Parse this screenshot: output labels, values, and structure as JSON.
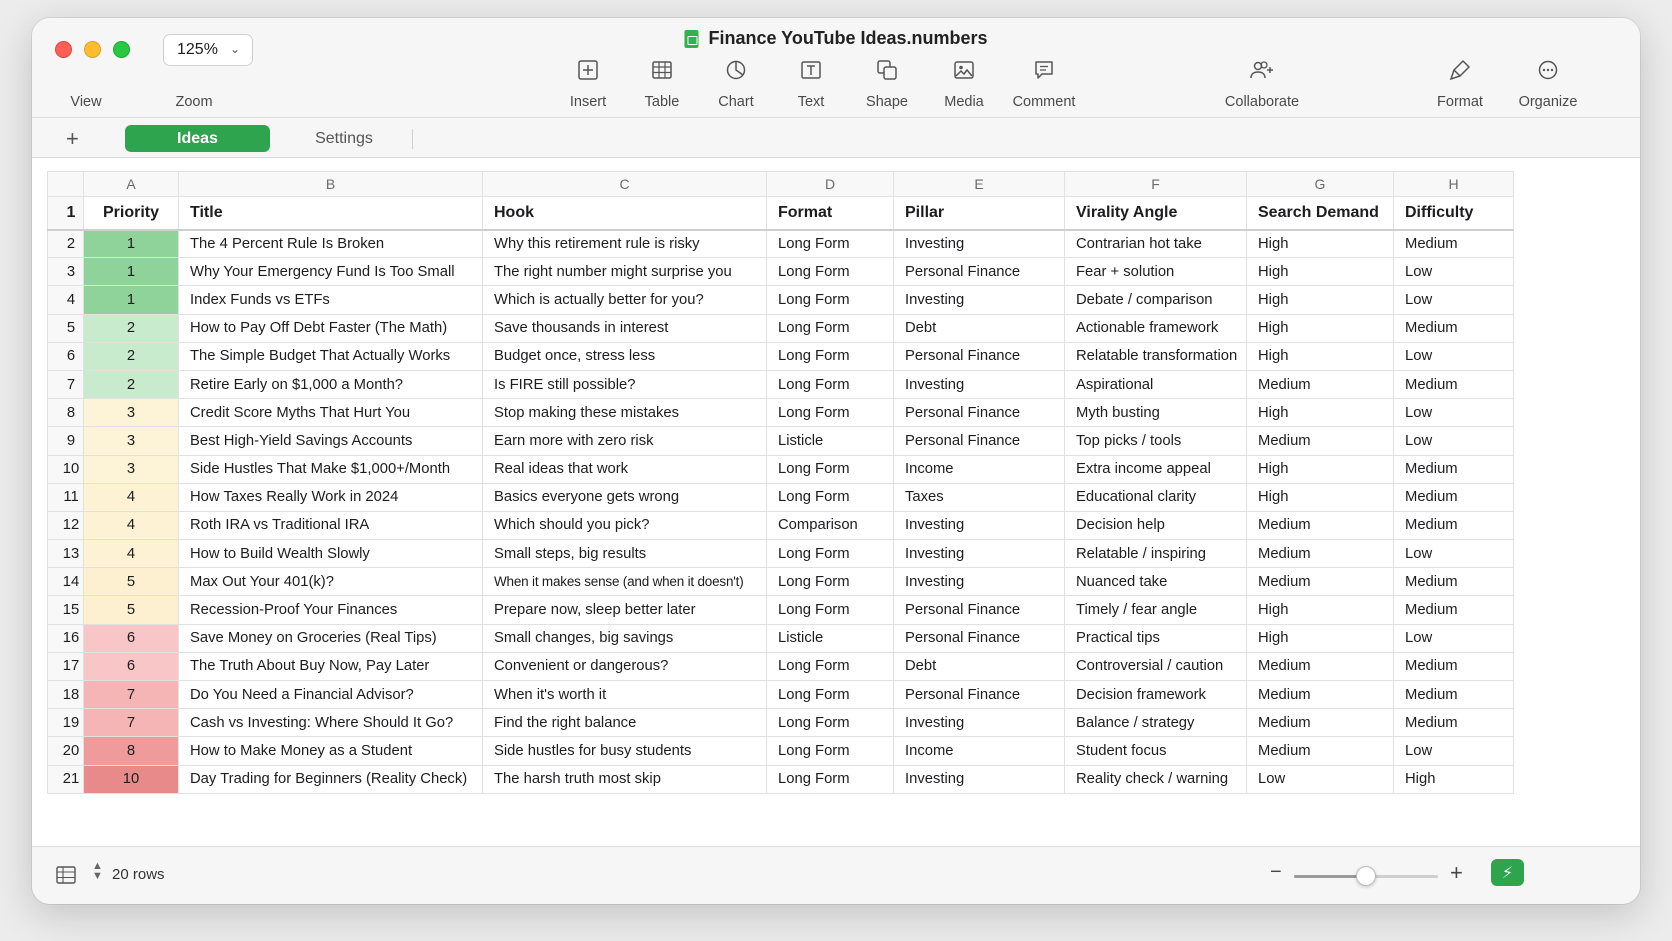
{
  "window": {
    "title": "Finance YouTube Ideas.numbers"
  },
  "toolbar": {
    "zoom_value": "125%",
    "view_label": "View",
    "zoom_label": "Zoom",
    "tools": [
      {
        "id": "insert",
        "label": "Insert",
        "icon": "insert-icon"
      },
      {
        "id": "table",
        "label": "Table",
        "icon": "table-icon"
      },
      {
        "id": "chart",
        "label": "Chart",
        "icon": "chart-icon"
      },
      {
        "id": "text",
        "label": "Text",
        "icon": "text-icon"
      },
      {
        "id": "shape",
        "label": "Shape",
        "icon": "shape-icon"
      },
      {
        "id": "media",
        "label": "Media",
        "icon": "media-icon"
      },
      {
        "id": "comment",
        "label": "Comment",
        "icon": "comment-icon"
      },
      {
        "id": "collaborate",
        "label": "Collaborate",
        "icon": "collaborate-icon"
      },
      {
        "id": "format",
        "label": "Format",
        "icon": "format-icon"
      },
      {
        "id": "organize",
        "label": "Organize",
        "icon": "organize-icon"
      }
    ]
  },
  "sheets": {
    "add_label": "+",
    "tabs": [
      "Ideas",
      "Settings"
    ],
    "active": "Ideas"
  },
  "grid": {
    "column_letters": [
      "A",
      "B",
      "C",
      "D",
      "E",
      "F",
      "G",
      "H"
    ],
    "headers": [
      "Priority",
      "Title",
      "Hook",
      "Format",
      "Pillar",
      "Virality Angle",
      "Search Demand",
      "Difficulty"
    ],
    "priority_colors": {
      "1": "#8fd39a",
      "2": "#c9ebcd",
      "3": "#fdf3d6",
      "4": "#fdf2d4",
      "5": "#fdf0d0",
      "6": "#f8c6c6",
      "7": "#f5b5b5",
      "8": "#ef9b9b",
      "10": "#e98a8a"
    },
    "rows": [
      [
        "1",
        "The 4 Percent Rule Is Broken",
        "Why this retirement rule is risky",
        "Long Form",
        "Investing",
        "Contrarian hot take",
        "High",
        "Medium"
      ],
      [
        "1",
        "Why Your Emergency Fund Is Too Small",
        "The right number might surprise you",
        "Long Form",
        "Personal Finance",
        "Fear + solution",
        "High",
        "Low"
      ],
      [
        "1",
        "Index Funds vs ETFs",
        "Which is actually better for you?",
        "Long Form",
        "Investing",
        "Debate / comparison",
        "High",
        "Low"
      ],
      [
        "2",
        "How to Pay Off Debt Faster (The Math)",
        "Save thousands in interest",
        "Long Form",
        "Debt",
        "Actionable framework",
        "High",
        "Medium"
      ],
      [
        "2",
        "The Simple Budget That Actually Works",
        "Budget once, stress less",
        "Long Form",
        "Personal Finance",
        "Relatable transformation",
        "High",
        "Low"
      ],
      [
        "2",
        "Retire Early on $1,000 a Month?",
        "Is FIRE still possible?",
        "Long Form",
        "Investing",
        "Aspirational",
        "Medium",
        "Medium"
      ],
      [
        "3",
        "Credit Score Myths That Hurt You",
        "Stop making these mistakes",
        "Long Form",
        "Personal Finance",
        "Myth busting",
        "High",
        "Low"
      ],
      [
        "3",
        "Best High-Yield Savings Accounts",
        "Earn more with zero risk",
        "Listicle",
        "Personal Finance",
        "Top picks / tools",
        "Medium",
        "Low"
      ],
      [
        "3",
        "Side Hustles That Make $1,000+/Month",
        "Real ideas that work",
        "Long Form",
        "Income",
        "Extra income appeal",
        "High",
        "Medium"
      ],
      [
        "4",
        "How Taxes Really Work in 2024",
        "Basics everyone gets wrong",
        "Long Form",
        "Taxes",
        "Educational clarity",
        "High",
        "Medium"
      ],
      [
        "4",
        "Roth IRA vs Traditional IRA",
        "Which should you pick?",
        "Comparison",
        "Investing",
        "Decision help",
        "Medium",
        "Medium"
      ],
      [
        "4",
        "How to Build Wealth Slowly",
        "Small steps, big results",
        "Long Form",
        "Investing",
        "Relatable / inspiring",
        "Medium",
        "Low"
      ],
      [
        "5",
        "Max Out Your 401(k)?",
        "When it makes sense (and when it doesn't)",
        "Long Form",
        "Investing",
        "Nuanced take",
        "Medium",
        "Medium"
      ],
      [
        "5",
        "Recession-Proof Your Finances",
        "Prepare now, sleep better later",
        "Long Form",
        "Personal Finance",
        "Timely / fear angle",
        "High",
        "Medium"
      ],
      [
        "6",
        "Save Money on Groceries (Real Tips)",
        "Small changes, big savings",
        "Listicle",
        "Personal Finance",
        "Practical tips",
        "High",
        "Low"
      ],
      [
        "6",
        "The Truth About Buy Now, Pay Later",
        "Convenient or dangerous?",
        "Long Form",
        "Debt",
        "Controversial / caution",
        "Medium",
        "Medium"
      ],
      [
        "7",
        "Do You Need a Financial Advisor?",
        "When it's worth it",
        "Long Form",
        "Personal Finance",
        "Decision framework",
        "Medium",
        "Medium"
      ],
      [
        "7",
        "Cash vs Investing: Where Should It Go?",
        "Find the right balance",
        "Long Form",
        "Investing",
        "Balance / strategy",
        "Medium",
        "Medium"
      ],
      [
        "8",
        "How to Make Money as a Student",
        "Side hustles for busy students",
        "Long Form",
        "Income",
        "Student focus",
        "Medium",
        "Low"
      ],
      [
        "10",
        "Day Trading for Beginners (Reality Check)",
        "The harsh truth most skip",
        "Long Form",
        "Investing",
        "Reality check / warning",
        "Low",
        "High"
      ]
    ]
  },
  "footer": {
    "rows_label": "20 rows",
    "zoom_minus": "−",
    "zoom_plus": "+",
    "zoom_slider_value": 0.5
  },
  "colors": {
    "accent": "#2ea44f"
  }
}
